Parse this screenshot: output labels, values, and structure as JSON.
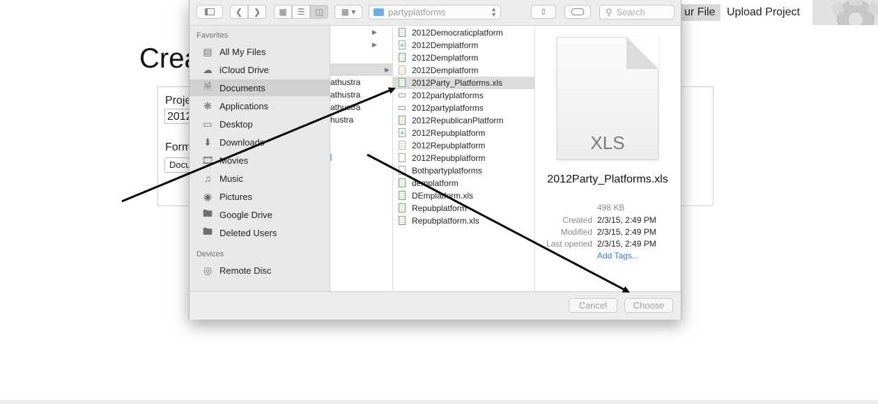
{
  "background_page": {
    "title_fragment": "Crea",
    "label_fragment_1": "Proje",
    "input_fragment": "2012",
    "label_fragment_2": "Form",
    "select_fragment": "Docu",
    "nav_your_file": "ur File",
    "nav_upload_project": "Upload Project"
  },
  "dialog": {
    "toolbar": {
      "path_folder": "partyplatforms",
      "search_placeholder": "Search"
    },
    "sidebar": {
      "favorites_heading": "Favorites",
      "favorites": [
        {
          "label": "All My Files",
          "icon": "all-files-icon"
        },
        {
          "label": "iCloud Drive",
          "icon": "cloud-icon"
        },
        {
          "label": "Documents",
          "icon": "documents-icon",
          "selected": true
        },
        {
          "label": "Applications",
          "icon": "applications-icon"
        },
        {
          "label": "Desktop",
          "icon": "desktop-icon"
        },
        {
          "label": "Downloads",
          "icon": "downloads-icon"
        },
        {
          "label": "Movies",
          "icon": "movies-icon"
        },
        {
          "label": "Music",
          "icon": "music-icon"
        },
        {
          "label": "Pictures",
          "icon": "pictures-icon"
        },
        {
          "label": "Google Drive",
          "icon": "folder-icon"
        },
        {
          "label": "Deleted Users",
          "icon": "folder-icon"
        }
      ],
      "devices_heading": "Devices",
      "devices": [
        {
          "label": "Remote Disc",
          "icon": "disc-icon"
        }
      ]
    },
    "column1": [
      {
        "label": "",
        "selected": true,
        "has_children": true
      },
      {
        "label": "athustra"
      },
      {
        "label": "athustra"
      },
      {
        "label": "athustra"
      },
      {
        "label": "hustra"
      }
    ],
    "column2": [
      {
        "name": "2012Democraticplatform",
        "icon": "sheet",
        "folder_arrow": true
      },
      {
        "name": "2012Demplatform",
        "icon": "text",
        "folder_arrow": true
      },
      {
        "name": "2012Demplatform",
        "icon": "sheet"
      },
      {
        "name": "2012Demplatform",
        "icon": "doc"
      },
      {
        "name": "2012Party_Platforms.xls",
        "icon": "sheet",
        "selected": true
      },
      {
        "name": "2012partyplatforms",
        "icon": "flat"
      },
      {
        "name": "2012partyplatforms",
        "icon": "flat"
      },
      {
        "name": "2012RepublicanPlatform",
        "icon": "sheet"
      },
      {
        "name": "2012Repubplatform",
        "icon": "text"
      },
      {
        "name": "2012Repubplatform",
        "icon": "doc"
      },
      {
        "name": "2012Repubplatform",
        "icon": "plain"
      },
      {
        "name": "Bothpartyplatforms",
        "icon": "plain"
      },
      {
        "name": "demplatform",
        "icon": "sheet"
      },
      {
        "name": "DEmplatform.xls",
        "icon": "sheet"
      },
      {
        "name": "Repubplatform",
        "icon": "sheet"
      },
      {
        "name": "Repubplatform.xls",
        "icon": "sheet"
      }
    ],
    "preview": {
      "type_label": "XLS",
      "file_name": "2012Party_Platforms.xls",
      "size": "498 KB",
      "created_label": "Created",
      "created_value": "2/3/15, 2:49 PM",
      "modified_label": "Modified",
      "modified_value": "2/3/15, 2:49 PM",
      "last_opened_label": "Last opened",
      "last_opened_value": "2/3/15, 2:49 PM",
      "add_tags": "Add Tags..."
    },
    "footer": {
      "cancel_label": "Cancel",
      "choose_label": "Choose"
    }
  },
  "colors": {
    "selection": "#dcdcdc",
    "sidebar_selection": "#d0d0d0",
    "link_blue": "#3478d6",
    "annotation_arrow": "#000000"
  }
}
